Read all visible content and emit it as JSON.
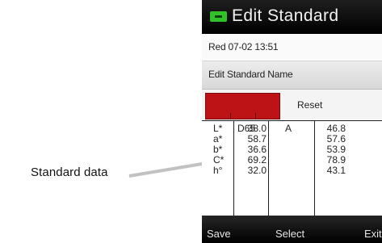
{
  "annotation": {
    "label": "Standard data"
  },
  "device": {
    "title": "Edit Standard",
    "sample_line": "Red 07-02 13:51",
    "edit_name_label": "Edit Standard Name",
    "swatch_color": "#bd1216",
    "reset_label": "Reset",
    "table": {
      "row_labels": [
        "L*",
        "a*",
        "b*",
        "C*",
        "h°"
      ],
      "illuminant_1": "D65",
      "values_1": [
        "38.0",
        "58.7",
        "36.6",
        "69.2",
        "32.0"
      ],
      "illuminant_2": "A",
      "values_2": [
        "46.8",
        "57.6",
        "53.9",
        "78.9",
        "43.1"
      ]
    },
    "softkeys": {
      "left": "Save",
      "center": "Select",
      "right": "Exit"
    }
  }
}
